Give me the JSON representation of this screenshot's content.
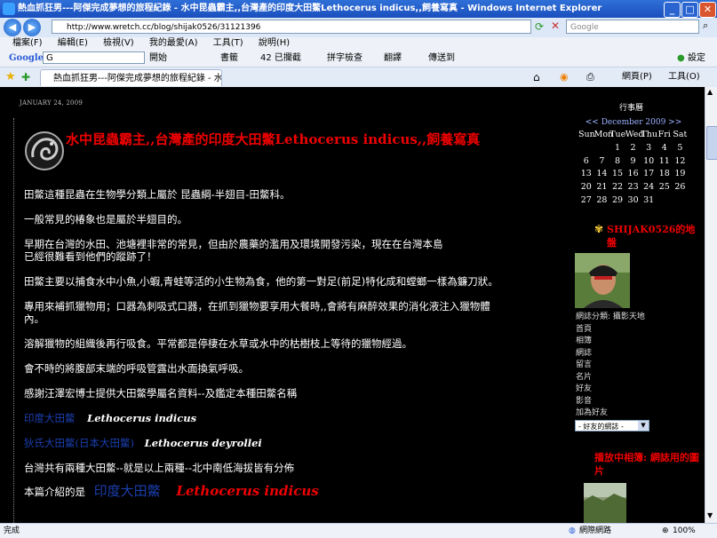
{
  "window": {
    "title": "熱血抓狂男---阿傑完成夢想的旅程紀錄 - 水中昆蟲霸主,,台灣產的印度大田鱉Lethocerus indicus,,飼養寫真 - Windows Internet Explorer"
  },
  "addressbar": {
    "url": "http://www.wretch.cc/blog/shijak0526/31121396",
    "search_placeholder": "Google"
  },
  "menubar": {
    "items": [
      "檔案(F)",
      "編輯(E)",
      "檢視(V)",
      "我的最愛(A)",
      "工具(T)",
      "說明(H)"
    ]
  },
  "googlebar": {
    "logo": "Google",
    "search_box": "G",
    "go": "開始",
    "bookmarks": "書籤",
    "blocked": "42 已攔截",
    "spellcheck": "拼字檢查",
    "translate": "翻譯",
    "sendto": "傳送到",
    "settings": "設定"
  },
  "tabbar": {
    "tab_title": "熱血抓狂男---阿傑完成夢想的旅程紀錄 - 水中昆...",
    "page_btn": "網頁(P)",
    "tools_btn": "工具(O)"
  },
  "post": {
    "date": "JANUARY 24, 2009",
    "title": "水中昆蟲霸主,,台灣產的印度大田鱉Lethocerus indicus,,飼養寫真",
    "paragraphs": [
      "田鱉這種昆蟲在生物學分類上屬於 昆蟲綱-半翅目-田鱉科。",
      "一般常見的椿象也是屬於半翅目的。",
      "早期在台灣的水田、池塘裡非常的常見，但由於農藥的濫用及環境開發污染，現在在台灣本島",
      "已經很難看到他們的蹤跡了！",
      "田鱉主要以捕食水中小魚,小蝦,青蛙等活的小生物為食，他的第一對足(前足)特化成和螳螂一樣為鐮刀狀。",
      "專用來補抓獵物用；口器為刺吸式口器，在抓到獵物要享用大餐時,,會將有麻醉效果的消化液注入獵物體",
      "內。",
      "溶解獵物的組織後再行吸食。平常都是停棲在水草或水中的枯樹枝上等待的獵物經過。",
      "會不時的將腹部末端的呼吸管露出水面換氣呼吸。",
      "感謝汪澤宏博士提供大田鱉學屬名資料--及鑑定本種田鱉名稱"
    ],
    "species1_name": "印度大田鱉",
    "species1_sci": "Lethocerus indicus",
    "species2_name": "狄氏大田鱉(日本大田鱉)",
    "species2_sci": "Lethocerus deyrollei",
    "dist_text": "台灣共有兩種大田鱉--就是以上兩種--北中南低海拔皆有分佈",
    "intro_label": "本篇介紹的是",
    "intro_name": "印度大田鱉",
    "intro_sci": "Lethocerus indicus"
  },
  "sidebar": {
    "calendar_title": "行事曆",
    "calendar_month": "<< December 2009 >>",
    "calendar_days": [
      "Sun",
      "Mon",
      "Tue",
      "Wed",
      "Thu",
      "Fri",
      "Sat"
    ],
    "calendar_weeks": [
      [
        "",
        "",
        "1",
        "2",
        "3",
        "4",
        "5"
      ],
      [
        "6",
        "7",
        "8",
        "9",
        "10",
        "11",
        "12"
      ],
      [
        "13",
        "14",
        "15",
        "16",
        "17",
        "18",
        "19"
      ],
      [
        "20",
        "21",
        "22",
        "23",
        "24",
        "25",
        "26"
      ],
      [
        "27",
        "28",
        "29",
        "30",
        "31",
        "",
        ""
      ]
    ],
    "profile_title": "SHIJAK0526的地盤",
    "blog_category": "網誌分類: 攝影天地",
    "links": [
      "首頁",
      "相簿",
      "網誌",
      "留言",
      "名片",
      "好友",
      "影音",
      "加為好友"
    ],
    "friend_select": "- 好友的網誌 -",
    "album_title": "播放中相簿: 網誌用的圖片"
  },
  "statusbar": {
    "left": "完成",
    "zone": "網際網路",
    "zoom": "100%"
  }
}
